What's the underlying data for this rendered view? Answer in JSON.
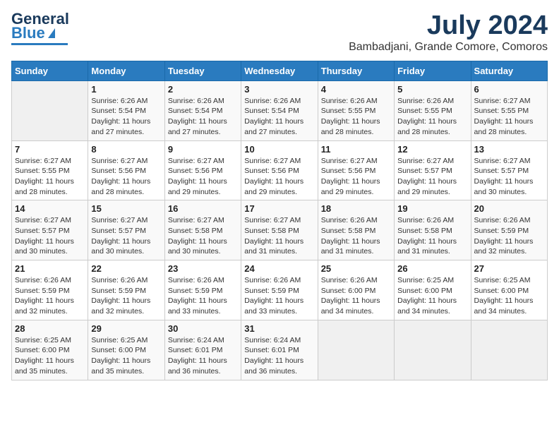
{
  "header": {
    "logo_line1": "General",
    "logo_line2": "Blue",
    "month": "July 2024",
    "location": "Bambadjani, Grande Comore, Comoros"
  },
  "days_of_week": [
    "Sunday",
    "Monday",
    "Tuesday",
    "Wednesday",
    "Thursday",
    "Friday",
    "Saturday"
  ],
  "weeks": [
    [
      {
        "num": "",
        "info": ""
      },
      {
        "num": "1",
        "info": "Sunrise: 6:26 AM\nSunset: 5:54 PM\nDaylight: 11 hours\nand 27 minutes."
      },
      {
        "num": "2",
        "info": "Sunrise: 6:26 AM\nSunset: 5:54 PM\nDaylight: 11 hours\nand 27 minutes."
      },
      {
        "num": "3",
        "info": "Sunrise: 6:26 AM\nSunset: 5:54 PM\nDaylight: 11 hours\nand 27 minutes."
      },
      {
        "num": "4",
        "info": "Sunrise: 6:26 AM\nSunset: 5:55 PM\nDaylight: 11 hours\nand 28 minutes."
      },
      {
        "num": "5",
        "info": "Sunrise: 6:26 AM\nSunset: 5:55 PM\nDaylight: 11 hours\nand 28 minutes."
      },
      {
        "num": "6",
        "info": "Sunrise: 6:27 AM\nSunset: 5:55 PM\nDaylight: 11 hours\nand 28 minutes."
      }
    ],
    [
      {
        "num": "7",
        "info": "Sunrise: 6:27 AM\nSunset: 5:55 PM\nDaylight: 11 hours\nand 28 minutes."
      },
      {
        "num": "8",
        "info": "Sunrise: 6:27 AM\nSunset: 5:56 PM\nDaylight: 11 hours\nand 28 minutes."
      },
      {
        "num": "9",
        "info": "Sunrise: 6:27 AM\nSunset: 5:56 PM\nDaylight: 11 hours\nand 29 minutes."
      },
      {
        "num": "10",
        "info": "Sunrise: 6:27 AM\nSunset: 5:56 PM\nDaylight: 11 hours\nand 29 minutes."
      },
      {
        "num": "11",
        "info": "Sunrise: 6:27 AM\nSunset: 5:56 PM\nDaylight: 11 hours\nand 29 minutes."
      },
      {
        "num": "12",
        "info": "Sunrise: 6:27 AM\nSunset: 5:57 PM\nDaylight: 11 hours\nand 29 minutes."
      },
      {
        "num": "13",
        "info": "Sunrise: 6:27 AM\nSunset: 5:57 PM\nDaylight: 11 hours\nand 30 minutes."
      }
    ],
    [
      {
        "num": "14",
        "info": "Sunrise: 6:27 AM\nSunset: 5:57 PM\nDaylight: 11 hours\nand 30 minutes."
      },
      {
        "num": "15",
        "info": "Sunrise: 6:27 AM\nSunset: 5:57 PM\nDaylight: 11 hours\nand 30 minutes."
      },
      {
        "num": "16",
        "info": "Sunrise: 6:27 AM\nSunset: 5:58 PM\nDaylight: 11 hours\nand 30 minutes."
      },
      {
        "num": "17",
        "info": "Sunrise: 6:27 AM\nSunset: 5:58 PM\nDaylight: 11 hours\nand 31 minutes."
      },
      {
        "num": "18",
        "info": "Sunrise: 6:26 AM\nSunset: 5:58 PM\nDaylight: 11 hours\nand 31 minutes."
      },
      {
        "num": "19",
        "info": "Sunrise: 6:26 AM\nSunset: 5:58 PM\nDaylight: 11 hours\nand 31 minutes."
      },
      {
        "num": "20",
        "info": "Sunrise: 6:26 AM\nSunset: 5:59 PM\nDaylight: 11 hours\nand 32 minutes."
      }
    ],
    [
      {
        "num": "21",
        "info": "Sunrise: 6:26 AM\nSunset: 5:59 PM\nDaylight: 11 hours\nand 32 minutes."
      },
      {
        "num": "22",
        "info": "Sunrise: 6:26 AM\nSunset: 5:59 PM\nDaylight: 11 hours\nand 32 minutes."
      },
      {
        "num": "23",
        "info": "Sunrise: 6:26 AM\nSunset: 5:59 PM\nDaylight: 11 hours\nand 33 minutes."
      },
      {
        "num": "24",
        "info": "Sunrise: 6:26 AM\nSunset: 5:59 PM\nDaylight: 11 hours\nand 33 minutes."
      },
      {
        "num": "25",
        "info": "Sunrise: 6:26 AM\nSunset: 6:00 PM\nDaylight: 11 hours\nand 34 minutes."
      },
      {
        "num": "26",
        "info": "Sunrise: 6:25 AM\nSunset: 6:00 PM\nDaylight: 11 hours\nand 34 minutes."
      },
      {
        "num": "27",
        "info": "Sunrise: 6:25 AM\nSunset: 6:00 PM\nDaylight: 11 hours\nand 34 minutes."
      }
    ],
    [
      {
        "num": "28",
        "info": "Sunrise: 6:25 AM\nSunset: 6:00 PM\nDaylight: 11 hours\nand 35 minutes."
      },
      {
        "num": "29",
        "info": "Sunrise: 6:25 AM\nSunset: 6:00 PM\nDaylight: 11 hours\nand 35 minutes."
      },
      {
        "num": "30",
        "info": "Sunrise: 6:24 AM\nSunset: 6:01 PM\nDaylight: 11 hours\nand 36 minutes."
      },
      {
        "num": "31",
        "info": "Sunrise: 6:24 AM\nSunset: 6:01 PM\nDaylight: 11 hours\nand 36 minutes."
      },
      {
        "num": "",
        "info": ""
      },
      {
        "num": "",
        "info": ""
      },
      {
        "num": "",
        "info": ""
      }
    ]
  ]
}
